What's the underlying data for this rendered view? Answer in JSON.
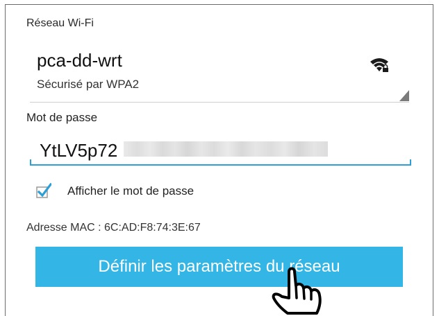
{
  "wifi": {
    "section_label": "Réseau Wi-Fi",
    "network_name": "pca-dd-wrt",
    "security": "Sécurisé par WPA2",
    "signal_icon": "wifi-lock-icon"
  },
  "password": {
    "label": "Mot de passe",
    "value_visible": "YtLV5p72",
    "accent_color": "#2d9fd6"
  },
  "show_password": {
    "label": "Afficher le mot de passe",
    "checked": true
  },
  "mac": {
    "label": "Adresse MAC : 6C:AD:F8:74:3E:67"
  },
  "apply_button": {
    "label": "Définir les paramètres du réseau",
    "color": "#33b5e5"
  },
  "cursor_icon": "hand-pointer-icon"
}
